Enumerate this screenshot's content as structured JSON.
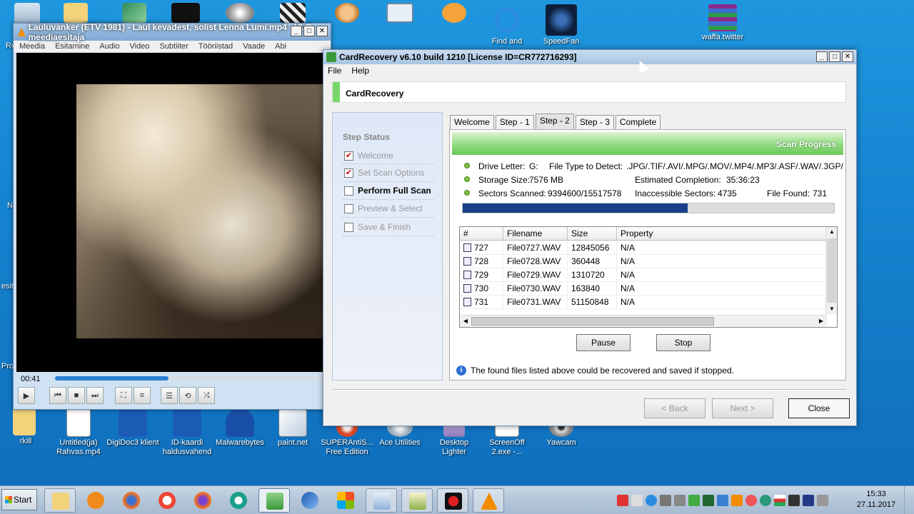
{
  "desktop": {
    "icons_top": [
      {
        "label": "Find and",
        "name": "find-and-icon"
      },
      {
        "label": "SpeedFan",
        "name": "speedfan-icon"
      },
      {
        "label": "waffa.twitter",
        "name": "winrar-archive-icon"
      }
    ],
    "icons_bottom": [
      {
        "label": "rkill",
        "name": "folder-icon"
      },
      {
        "label": "Untitled(ja) Rahvas.mp4",
        "name": "video-file-icon"
      },
      {
        "label": "DigiDoc3 klient",
        "name": "digidoc-icon"
      },
      {
        "label": "ID-kaardi haldusvahend",
        "name": "id-card-icon"
      },
      {
        "label": "Malwarebytes",
        "name": "malwarebytes-icon"
      },
      {
        "label": "paint.net",
        "name": "paint-net-icon"
      },
      {
        "label": "SUPERAntiS... Free Edition",
        "name": "superantispyware-icon"
      },
      {
        "label": "Ace Utilities",
        "name": "ace-utilities-icon"
      },
      {
        "label": "Desktop Lighter",
        "name": "desktop-lighter-icon"
      },
      {
        "label": "ScreenOff 2.exe -...",
        "name": "screenoff-icon"
      },
      {
        "label": "Yawcam",
        "name": "yawcam-icon"
      }
    ],
    "edge_labels": [
      "Re",
      "N",
      "esit",
      "Pro"
    ]
  },
  "vlc": {
    "title": "Lauluvanker (ETV 1981) - Laul kevadest, solist Lenna Lumi.mp4 - VLC meediaesitaja",
    "menu": [
      "Meedia",
      "Esitamine",
      "Audio",
      "Video",
      "Subtiiter",
      "Tööriistad",
      "Vaade",
      "Abi"
    ],
    "time": "00:41",
    "progress_fraction": 0.42
  },
  "cardrecovery": {
    "title": "CardRecovery v6.10 build 1210  [License ID=CR772716293]",
    "menu": [
      "File",
      "Help"
    ],
    "banner": "CardRecovery",
    "step_status_header": "Step Status",
    "steps": [
      {
        "label": "Welcome",
        "checked": true,
        "current": false
      },
      {
        "label": "Set Scan Options",
        "checked": true,
        "current": false
      },
      {
        "label": "Perform Full Scan",
        "checked": false,
        "current": true
      },
      {
        "label": "Preview & Select",
        "checked": false,
        "current": false
      },
      {
        "label": "Save & Finish",
        "checked": false,
        "current": false
      }
    ],
    "tabs": [
      "Welcome",
      "Step - 1",
      "Step - 2",
      "Step - 3",
      "Complete"
    ],
    "active_tab": "Step - 2",
    "scan_header": "Scan Progress",
    "drive_letter_label": "Drive Letter:",
    "drive_letter": "G:",
    "file_type_label": "File Type to Detect:",
    "file_types": ".JPG/.TIF/.AVI/.MPG/.MOV/.MP4/.MP3/.ASF/.WAV/.3GP/",
    "storage_size_label": "Storage Size:",
    "storage_size": "7576 MB",
    "estimated_completion_label": "Estimated Completion:",
    "estimated_completion": "35:36:23",
    "sectors_scanned_label": "Sectors Scanned:",
    "sectors_scanned": "9394600/15517578",
    "inaccessible_label": "Inaccessible  Sectors:",
    "inaccessible": "4735",
    "file_found_label": "File Found:",
    "file_found": "731",
    "scan_progress_fraction": 0.605,
    "table_headers": [
      "#",
      "Filename",
      "Size",
      "Property"
    ],
    "rows": [
      {
        "num": "727",
        "filename": "File0727.WAV",
        "size": "12845056",
        "property": "N/A"
      },
      {
        "num": "728",
        "filename": "File0728.WAV",
        "size": "360448",
        "property": "N/A"
      },
      {
        "num": "729",
        "filename": "File0729.WAV",
        "size": "1310720",
        "property": "N/A"
      },
      {
        "num": "730",
        "filename": "File0730.WAV",
        "size": "163840",
        "property": "N/A"
      },
      {
        "num": "731",
        "filename": "File0731.WAV",
        "size": "51150848",
        "property": "N/A"
      }
    ],
    "pause_label": "Pause",
    "stop_label": "Stop",
    "note": "The found files listed above could be recovered and saved if stopped.",
    "back_label": "< Back",
    "next_label": "Next >",
    "close_label": "Close"
  },
  "taskbar": {
    "start_label": "Start",
    "clock_time": "15:33",
    "clock_date": "27.11.2017"
  },
  "colors": {
    "desktop_blue": "#1583cf",
    "scan_green": "#6cc85a",
    "progress_navy": "#1a3f8a",
    "vlc_orange": "#f28b00"
  }
}
